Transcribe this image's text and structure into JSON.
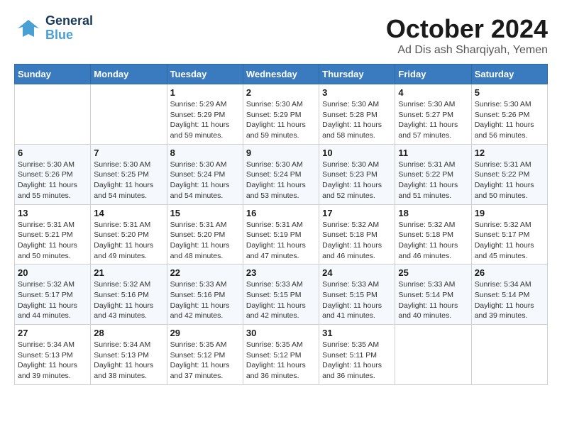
{
  "header": {
    "logo_general": "General",
    "logo_blue": "Blue",
    "month_title": "October 2024",
    "location": "Ad Dis ash Sharqiyah, Yemen"
  },
  "days_of_week": [
    "Sunday",
    "Monday",
    "Tuesday",
    "Wednesday",
    "Thursday",
    "Friday",
    "Saturday"
  ],
  "weeks": [
    [
      {
        "day": "",
        "info": ""
      },
      {
        "day": "",
        "info": ""
      },
      {
        "day": "1",
        "info": "Sunrise: 5:29 AM\nSunset: 5:29 PM\nDaylight: 11 hours and 59 minutes."
      },
      {
        "day": "2",
        "info": "Sunrise: 5:30 AM\nSunset: 5:29 PM\nDaylight: 11 hours and 59 minutes."
      },
      {
        "day": "3",
        "info": "Sunrise: 5:30 AM\nSunset: 5:28 PM\nDaylight: 11 hours and 58 minutes."
      },
      {
        "day": "4",
        "info": "Sunrise: 5:30 AM\nSunset: 5:27 PM\nDaylight: 11 hours and 57 minutes."
      },
      {
        "day": "5",
        "info": "Sunrise: 5:30 AM\nSunset: 5:26 PM\nDaylight: 11 hours and 56 minutes."
      }
    ],
    [
      {
        "day": "6",
        "info": "Sunrise: 5:30 AM\nSunset: 5:26 PM\nDaylight: 11 hours and 55 minutes."
      },
      {
        "day": "7",
        "info": "Sunrise: 5:30 AM\nSunset: 5:25 PM\nDaylight: 11 hours and 54 minutes."
      },
      {
        "day": "8",
        "info": "Sunrise: 5:30 AM\nSunset: 5:24 PM\nDaylight: 11 hours and 54 minutes."
      },
      {
        "day": "9",
        "info": "Sunrise: 5:30 AM\nSunset: 5:24 PM\nDaylight: 11 hours and 53 minutes."
      },
      {
        "day": "10",
        "info": "Sunrise: 5:30 AM\nSunset: 5:23 PM\nDaylight: 11 hours and 52 minutes."
      },
      {
        "day": "11",
        "info": "Sunrise: 5:31 AM\nSunset: 5:22 PM\nDaylight: 11 hours and 51 minutes."
      },
      {
        "day": "12",
        "info": "Sunrise: 5:31 AM\nSunset: 5:22 PM\nDaylight: 11 hours and 50 minutes."
      }
    ],
    [
      {
        "day": "13",
        "info": "Sunrise: 5:31 AM\nSunset: 5:21 PM\nDaylight: 11 hours and 50 minutes."
      },
      {
        "day": "14",
        "info": "Sunrise: 5:31 AM\nSunset: 5:20 PM\nDaylight: 11 hours and 49 minutes."
      },
      {
        "day": "15",
        "info": "Sunrise: 5:31 AM\nSunset: 5:20 PM\nDaylight: 11 hours and 48 minutes."
      },
      {
        "day": "16",
        "info": "Sunrise: 5:31 AM\nSunset: 5:19 PM\nDaylight: 11 hours and 47 minutes."
      },
      {
        "day": "17",
        "info": "Sunrise: 5:32 AM\nSunset: 5:18 PM\nDaylight: 11 hours and 46 minutes."
      },
      {
        "day": "18",
        "info": "Sunrise: 5:32 AM\nSunset: 5:18 PM\nDaylight: 11 hours and 46 minutes."
      },
      {
        "day": "19",
        "info": "Sunrise: 5:32 AM\nSunset: 5:17 PM\nDaylight: 11 hours and 45 minutes."
      }
    ],
    [
      {
        "day": "20",
        "info": "Sunrise: 5:32 AM\nSunset: 5:17 PM\nDaylight: 11 hours and 44 minutes."
      },
      {
        "day": "21",
        "info": "Sunrise: 5:32 AM\nSunset: 5:16 PM\nDaylight: 11 hours and 43 minutes."
      },
      {
        "day": "22",
        "info": "Sunrise: 5:33 AM\nSunset: 5:16 PM\nDaylight: 11 hours and 42 minutes."
      },
      {
        "day": "23",
        "info": "Sunrise: 5:33 AM\nSunset: 5:15 PM\nDaylight: 11 hours and 42 minutes."
      },
      {
        "day": "24",
        "info": "Sunrise: 5:33 AM\nSunset: 5:15 PM\nDaylight: 11 hours and 41 minutes."
      },
      {
        "day": "25",
        "info": "Sunrise: 5:33 AM\nSunset: 5:14 PM\nDaylight: 11 hours and 40 minutes."
      },
      {
        "day": "26",
        "info": "Sunrise: 5:34 AM\nSunset: 5:14 PM\nDaylight: 11 hours and 39 minutes."
      }
    ],
    [
      {
        "day": "27",
        "info": "Sunrise: 5:34 AM\nSunset: 5:13 PM\nDaylight: 11 hours and 39 minutes."
      },
      {
        "day": "28",
        "info": "Sunrise: 5:34 AM\nSunset: 5:13 PM\nDaylight: 11 hours and 38 minutes."
      },
      {
        "day": "29",
        "info": "Sunrise: 5:35 AM\nSunset: 5:12 PM\nDaylight: 11 hours and 37 minutes."
      },
      {
        "day": "30",
        "info": "Sunrise: 5:35 AM\nSunset: 5:12 PM\nDaylight: 11 hours and 36 minutes."
      },
      {
        "day": "31",
        "info": "Sunrise: 5:35 AM\nSunset: 5:11 PM\nDaylight: 11 hours and 36 minutes."
      },
      {
        "day": "",
        "info": ""
      },
      {
        "day": "",
        "info": ""
      }
    ]
  ]
}
